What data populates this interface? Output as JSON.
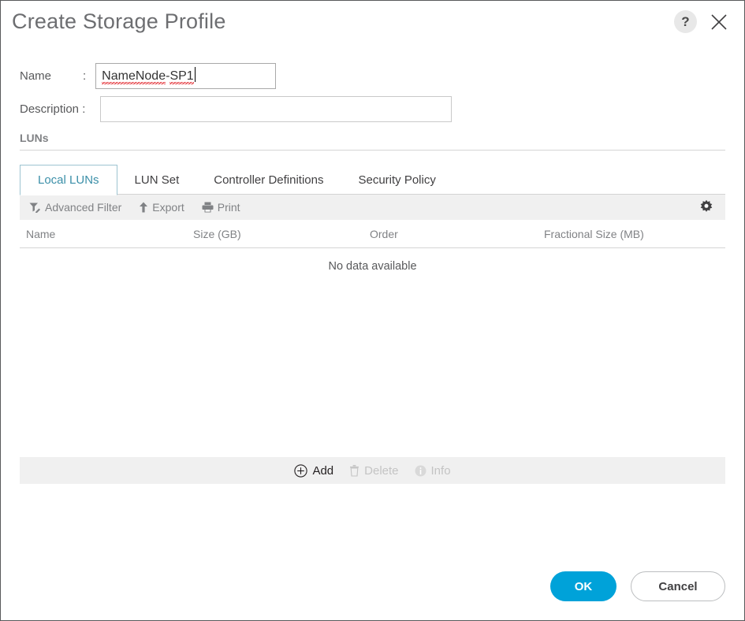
{
  "dialog": {
    "title": "Create Storage Profile",
    "help_label": "?",
    "close_icon": "close-icon"
  },
  "form": {
    "name": {
      "label": "Name",
      "colon": ":",
      "value": "NameNode-SP1",
      "value_part1": "NameNode",
      "value_separator": "-",
      "value_part2": "SP1",
      "placeholder": ""
    },
    "description": {
      "label": "Description :",
      "value": "",
      "placeholder": ""
    }
  },
  "section": {
    "title": "LUNs"
  },
  "tabs": [
    {
      "label": "Local LUNs",
      "active": true
    },
    {
      "label": "LUN Set",
      "active": false
    },
    {
      "label": "Controller Definitions",
      "active": false
    },
    {
      "label": "Security Policy",
      "active": false
    }
  ],
  "grid_toolbar": {
    "advanced_filter": "Advanced Filter",
    "export": "Export",
    "print": "Print",
    "settings_icon": "gear-icon"
  },
  "table": {
    "columns": [
      "Name",
      "Size (GB)",
      "Order",
      "Fractional Size (MB)"
    ],
    "rows": [],
    "empty_message": "No data available"
  },
  "grid_actions": {
    "add": "Add",
    "delete": "Delete",
    "info": "Info"
  },
  "footer": {
    "ok": "OK",
    "cancel": "Cancel"
  },
  "colors": {
    "accent": "#00a2d9",
    "tab_active_text": "#3b8fa8",
    "tab_active_border": "#9dc4d1",
    "toolbar_bg": "#f0f0f0",
    "label_text": "#58595b",
    "muted_text": "#808285",
    "spellcheck_underline": "#e11b22",
    "dialog_border": "#58595b"
  }
}
